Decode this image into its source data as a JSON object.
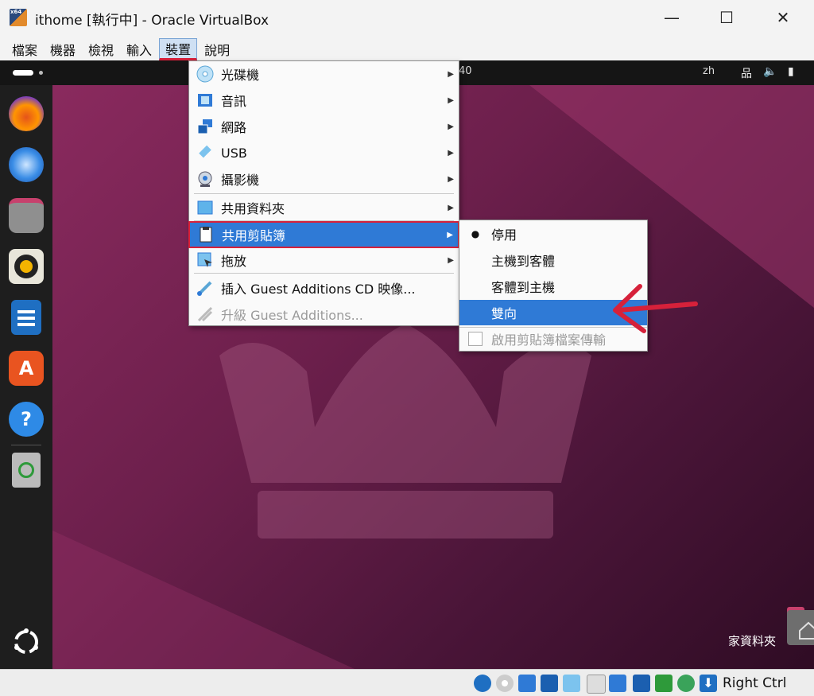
{
  "window": {
    "title": "ithome [執行中] - Oracle VirtualBox",
    "app_badge": "x64",
    "minimize": "—",
    "maximize": "☐",
    "close": "✕"
  },
  "menubar": [
    "檔案",
    "機器",
    "檢視",
    "輸入",
    "裝置",
    "說明"
  ],
  "guest": {
    "clock_tail": "40",
    "lang": "zh",
    "tray_network": "品",
    "tray_volume": "🔈",
    "tray_battery": "▮",
    "dock_help": "?",
    "dock_store": "A",
    "home_folder_label": "家資料夾"
  },
  "devices_menu": {
    "items": [
      {
        "label": "光碟機",
        "icon": "optical-disc-icon"
      },
      {
        "label": "音訊",
        "icon": "audio-icon"
      },
      {
        "label": "網路",
        "icon": "network-icon"
      },
      {
        "label": "USB",
        "icon": "usb-icon"
      },
      {
        "label": "攝影機",
        "icon": "webcam-icon"
      },
      {
        "label": "共用資料夾",
        "icon": "shared-folder-icon"
      },
      {
        "label": "共用剪貼簿",
        "icon": "clipboard-icon"
      },
      {
        "label": "拖放",
        "icon": "drag-drop-icon"
      },
      {
        "label": "插入 Guest Additions CD 映像...",
        "icon": "insert-cd-icon"
      },
      {
        "label": "升級 Guest Additions...",
        "icon": "upgrade-icon"
      }
    ]
  },
  "clipboard_submenu": {
    "bullet": "●",
    "items": [
      "停用",
      "主機到客體",
      "客體到主機",
      "雙向"
    ],
    "checkbox_label": "啟用剪貼簿檔案傳輸"
  },
  "statusbar": {
    "host_key": "Right Ctrl"
  },
  "colors": {
    "highlight": "#2f7ad6",
    "annotation_red": "#d6213a"
  }
}
